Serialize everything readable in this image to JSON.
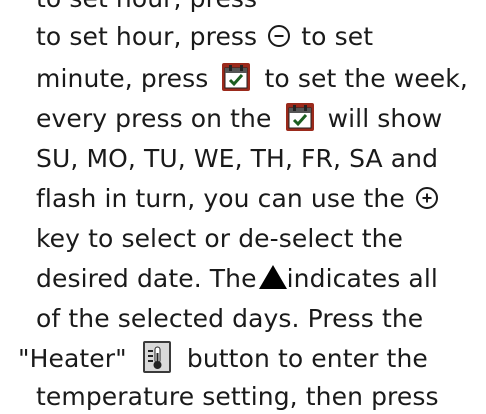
{
  "text": {
    "line0": "to set hour, press",
    "line1_a": "to set hour, press",
    "line1_b": "to set",
    "line2_a": "minute, press",
    "line2_b": "to set the week,",
    "line3_a": "every press on the",
    "line3_b": "will show",
    "line4": "SU, MO, TU, WE, TH, FR, SA and",
    "line5_a": "flash in turn, you can use the",
    "line6": "key to select or de-select the",
    "line7_a": "desired date. The",
    "line7_b": "indicates all",
    "line8": "of the selected days. Press the",
    "line9_a": "\"Heater\"",
    "line9_b": "button to enter the",
    "line10": "temperature setting, then press"
  },
  "icons": {
    "minus_key": "minus-circle-icon",
    "plus_key": "plus-circle-icon",
    "calendar_key": "calendar-check-icon",
    "heater_key": "heater-thermometer-icon",
    "indicator": "triangle-up-icon"
  },
  "colors": {
    "text": "#1a1a1a",
    "calendar_key_bg": "#9b2a1c",
    "heater_key_bg": "#3a3a3a"
  }
}
